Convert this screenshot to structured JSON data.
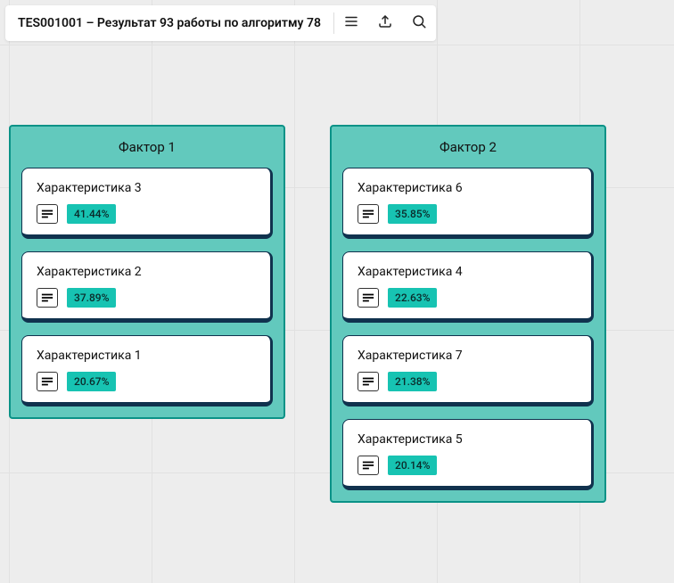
{
  "header": {
    "title": "TES001001 – Результат 93 работы по алгоритму 78"
  },
  "factors": [
    {
      "title": "Фактор 1",
      "items": [
        {
          "name": "Характеристика 3",
          "pct": "41.44%"
        },
        {
          "name": "Характеристика 2",
          "pct": "37.89%"
        },
        {
          "name": "Характеристика 1",
          "pct": "20.67%"
        }
      ]
    },
    {
      "title": "Фактор 2",
      "items": [
        {
          "name": "Характеристика 6",
          "pct": "35.85%"
        },
        {
          "name": "Характеристика 4",
          "pct": "22.63%"
        },
        {
          "name": "Характеристика 7",
          "pct": "21.38%"
        },
        {
          "name": "Характеристика 5",
          "pct": "20.14%"
        }
      ]
    }
  ]
}
